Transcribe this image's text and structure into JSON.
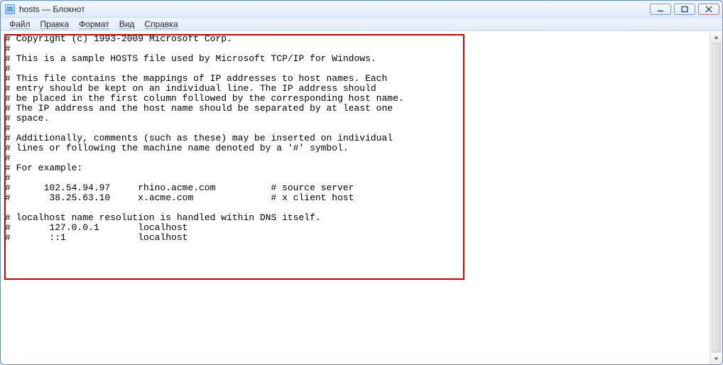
{
  "window": {
    "title": "hosts — Блокнот"
  },
  "menu": {
    "file": "Файл",
    "edit": "Правка",
    "format": "Формат",
    "view": "Вид",
    "help": "Справка"
  },
  "content": "# Copyright (c) 1993-2009 Microsoft Corp.\n#\n# This is a sample HOSTS file used by Microsoft TCP/IP for Windows.\n#\n# This file contains the mappings of IP addresses to host names. Each\n# entry should be kept on an individual line. The IP address should\n# be placed in the first column followed by the corresponding host name.\n# The IP address and the host name should be separated by at least one\n# space.\n#\n# Additionally, comments (such as these) may be inserted on individual\n# lines or following the machine name denoted by a '#' symbol.\n#\n# For example:\n#\n#      102.54.94.97     rhino.acme.com          # source server\n#       38.25.63.10     x.acme.com              # x client host\n\n# localhost name resolution is handled within DNS itself.\n#\t127.0.0.1       localhost\n#\t::1             localhost"
}
